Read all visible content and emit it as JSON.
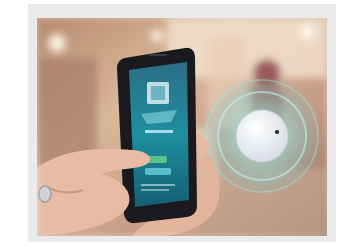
{
  "photo": {
    "description_icon": "smartphone-app-and-beacon-photo-icon",
    "colors": {
      "frame": "#ebebeb",
      "store_warm": "#c79a7a",
      "store_light": "#f1ddc6",
      "phone_body": "#1a1a1e",
      "screen_teal": "#1e8fa0",
      "beacon_white": "#f5f6f8",
      "beacon_glow": "#8fdcd8"
    }
  }
}
